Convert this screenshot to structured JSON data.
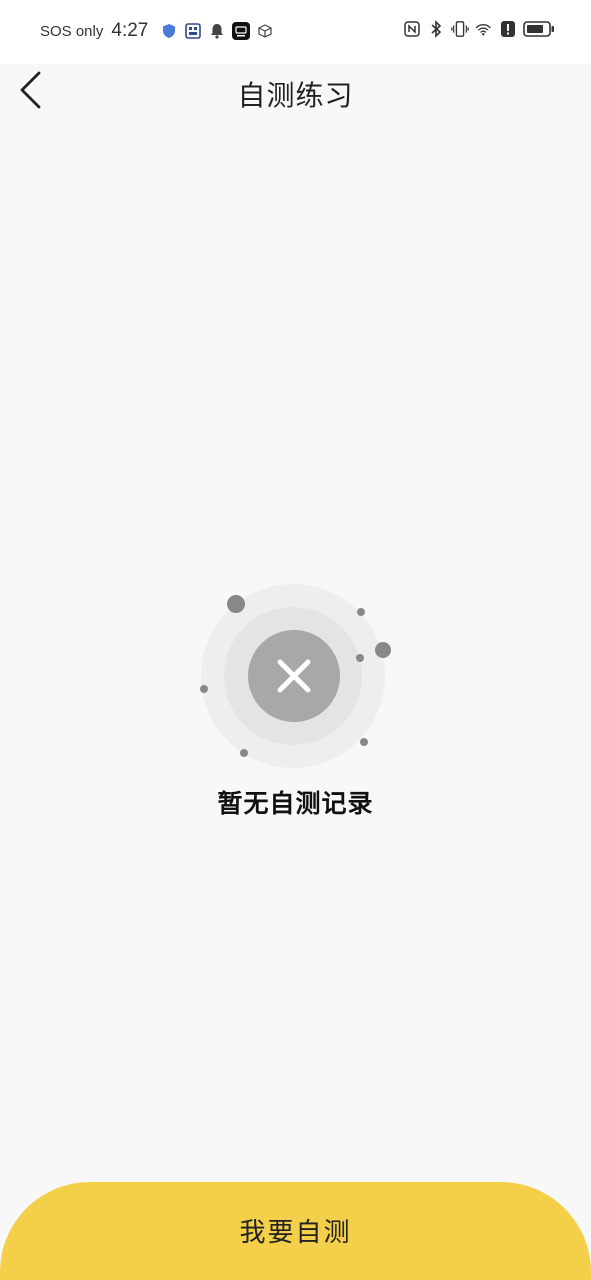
{
  "status_bar": {
    "carrier_text": "SOS only",
    "time": "4:27",
    "left_icons": [
      "shield-icon",
      "app-icon",
      "bell-icon",
      "app-badge-icon",
      "cube-icon"
    ],
    "right_icons": [
      "nfc-icon",
      "bluetooth-icon",
      "vibrate-icon",
      "wifi-icon",
      "alert-icon",
      "battery-icon"
    ]
  },
  "header": {
    "title": "自测练习",
    "back_icon": "chevron-left-icon"
  },
  "empty_state": {
    "icon": "close-icon",
    "message": "暂无自测记录"
  },
  "footer": {
    "button_label": "我要自测"
  },
  "colors": {
    "page_background": "#f8f8f8",
    "button_background": "#f4cf4a",
    "illustration_outer": "#eeeeee",
    "illustration_mid": "#e4e4e4",
    "illustration_core": "#a8a8a8",
    "dot": "#888888"
  }
}
